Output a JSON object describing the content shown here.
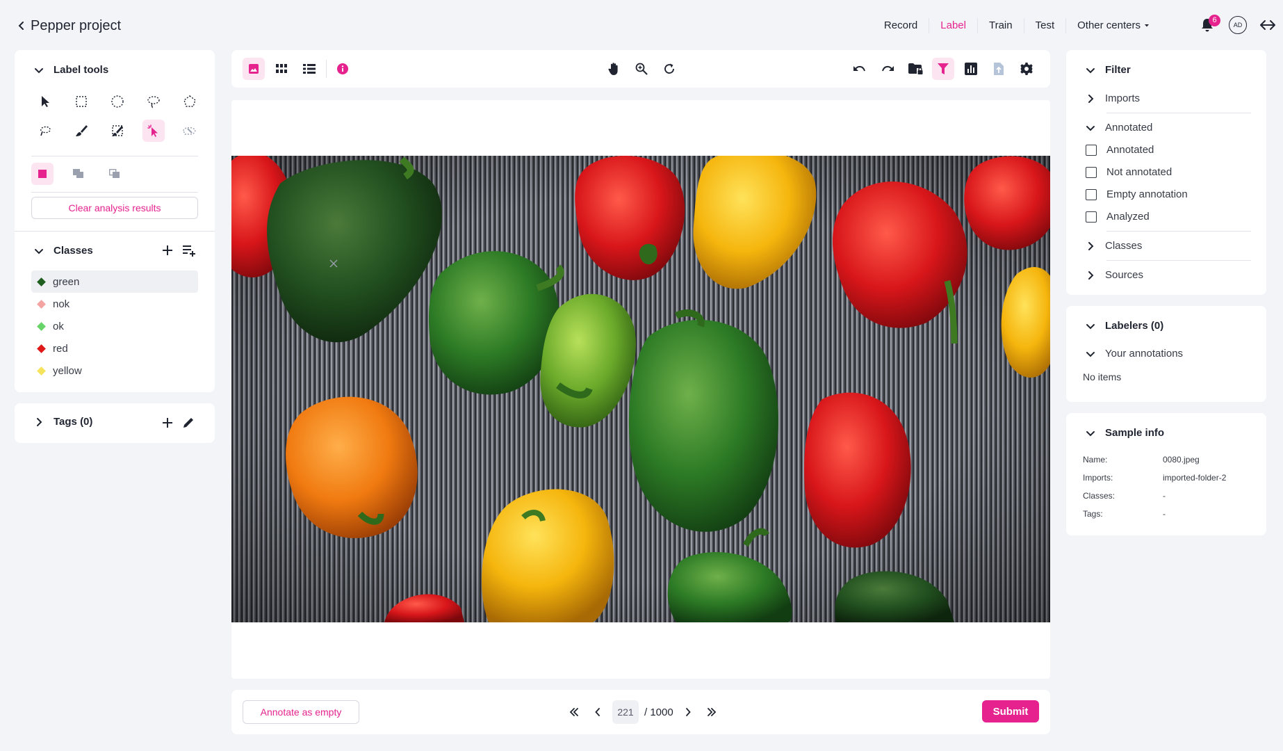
{
  "app": {
    "project_title": "Pepper project",
    "accent_color": "#e6228e"
  },
  "nav": {
    "record": "Record",
    "label": "Label",
    "train": "Train",
    "test": "Test",
    "other_centers": "Other centers",
    "active": "Label"
  },
  "header": {
    "notifications_count": "6",
    "avatar_initials": "AD"
  },
  "label_tools": {
    "title": "Label tools",
    "tools": [
      "select-arrow",
      "rectangle",
      "ellipse",
      "lasso",
      "polygon",
      "freehand-lasso",
      "brush",
      "eraser",
      "smart-select",
      "magic-wand"
    ],
    "active_tool": "smart-select",
    "modes": [
      "fill",
      "union",
      "subtract"
    ],
    "clear_button": "Clear analysis results"
  },
  "classes": {
    "title": "Classes",
    "items": [
      {
        "label": "green",
        "color": "#1e5e1e"
      },
      {
        "label": "nok",
        "color": "#f4a3a3"
      },
      {
        "label": "ok",
        "color": "#66d466"
      },
      {
        "label": "red",
        "color": "#e01818"
      },
      {
        "label": "yellow",
        "color": "#f5e35c"
      }
    ],
    "selected": "green"
  },
  "tags": {
    "title": "Tags (0)"
  },
  "toolbar": {
    "left_icons": [
      "image-view",
      "grid-view",
      "list-view",
      "info"
    ],
    "center_icons": [
      "pan",
      "zoom",
      "refresh"
    ],
    "right_icons": [
      "undo",
      "redo",
      "folder-lock",
      "filter",
      "chart",
      "export",
      "settings"
    ]
  },
  "pagination": {
    "current": "221",
    "total": "/ 1000"
  },
  "bottom": {
    "annotate_empty": "Annotate as empty",
    "submit": "Submit"
  },
  "filter": {
    "title": "Filter",
    "imports": "Imports",
    "annotated_header": "Annotated",
    "options": [
      "Annotated",
      "Not annotated",
      "Empty annotation",
      "Analyzed"
    ],
    "classes": "Classes",
    "sources": "Sources"
  },
  "labelers": {
    "title": "Labelers (0)",
    "your_annotations": "Your annotations",
    "empty_text": "No items"
  },
  "sample_info": {
    "title": "Sample info",
    "rows": [
      {
        "key": "Name:",
        "value": "0080.jpeg"
      },
      {
        "key": "Imports:",
        "value": "imported-folder-2"
      },
      {
        "key": "Classes:",
        "value": "-"
      },
      {
        "key": "Tags:",
        "value": "-"
      }
    ]
  }
}
